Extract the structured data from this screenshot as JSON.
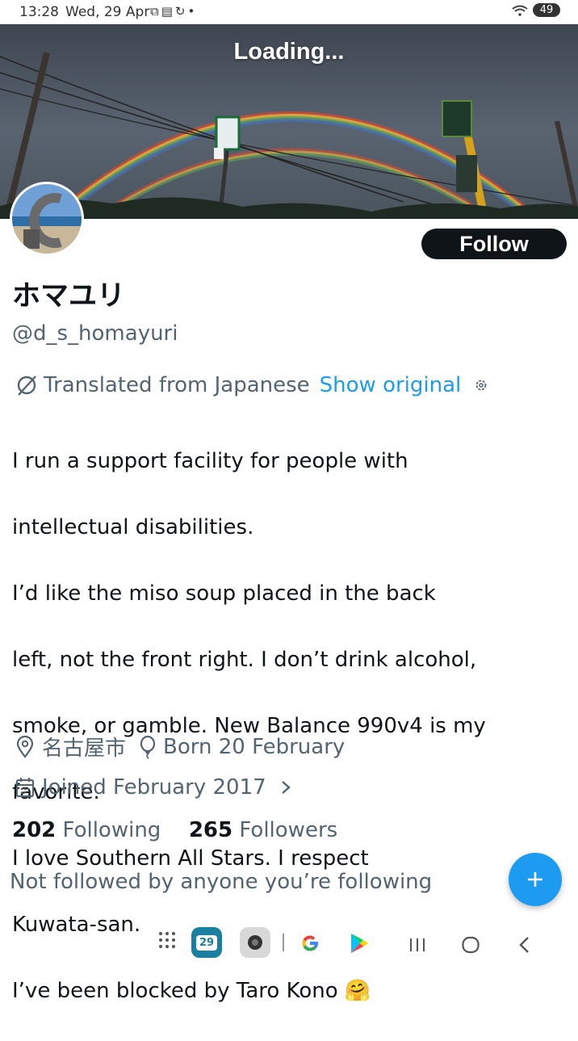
{
  "status_bar": {
    "time": "13:28",
    "date": "Wed, 29 Apr",
    "notification_icons": [
      "screenshot-icon",
      "calendar-icon",
      "sync-icon",
      "dot-icon"
    ],
    "battery": "49"
  },
  "banner": {
    "loading_text": "Loading..."
  },
  "profile": {
    "follow_label": "Follow",
    "display_name": "ホマユリ",
    "handle": "@d_s_homayuri",
    "translated_label": "Translated from Japanese",
    "show_original_label": "Show original",
    "bio_lines": [
      "I run a support facility for people with",
      "intellectual disabilities.",
      "I’d like the miso soup placed in the back",
      "left, not the front right. I don’t drink alcohol,",
      "smoke, or gamble. New Balance 990v4 is my",
      "favorite.",
      "I love Southern All Stars. I respect",
      "Kuwata-san.",
      "I’ve been blocked by Taro Kono 🤗"
    ],
    "location": "名古屋市",
    "birthday": "Born 20 February",
    "joined": "Joined February 2017",
    "following_count": "202",
    "following_label": "Following",
    "followers_count": "265",
    "followers_label": "Followers",
    "not_followed_text": "Not followed by anyone you’re following"
  },
  "nav_bar": {
    "calendar_day": "29",
    "icons": [
      "apps-grid-icon",
      "calendar-app-icon",
      "camera-app-icon",
      "google-app-icon",
      "play-store-icon",
      "recents-icon",
      "home-icon",
      "back-icon"
    ]
  },
  "colors": {
    "accent": "#1d9bf0",
    "text_primary": "#0f1419",
    "text_secondary": "#536471",
    "follow_bg": "#0f1419"
  }
}
